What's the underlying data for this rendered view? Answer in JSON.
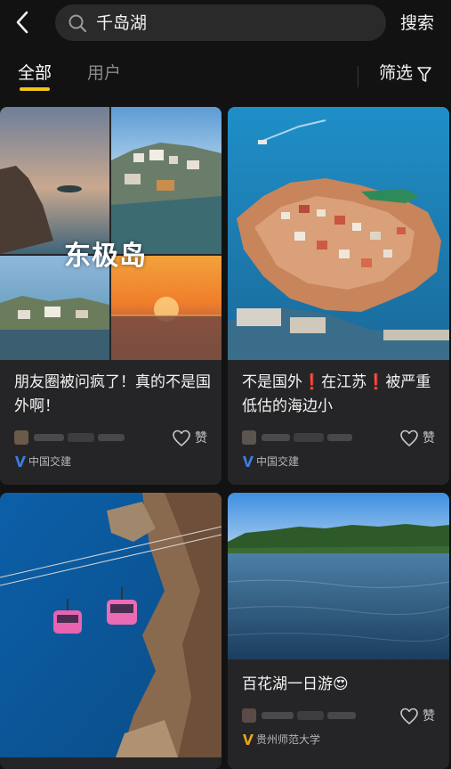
{
  "header": {
    "search_query": "千岛湖",
    "search_button": "搜索"
  },
  "tabs": [
    {
      "label": "全部",
      "active": true
    },
    {
      "label": "用户",
      "active": false
    }
  ],
  "filter_label": "筛选",
  "cards": [
    {
      "image_caption": "东极岛",
      "title": "朋友圈被问疯了！真的不是国外啊！",
      "like_label": "赞",
      "badge": "中国交建",
      "badge_color": "#3f7fe0"
    },
    {
      "title": "不是国外❗在江苏❗被严重低估的海边小",
      "like_label": "赞",
      "badge": "中国交建",
      "badge_color": "#3f7fe0"
    },
    {
      "title": ""
    },
    {
      "title": "百花湖一日游😍",
      "like_label": "赞",
      "badge": "贵州师范大学",
      "badge_color": "#e8a617"
    }
  ],
  "colors": {
    "accent": "#f5c518",
    "background": "#121212",
    "card": "#252527"
  }
}
